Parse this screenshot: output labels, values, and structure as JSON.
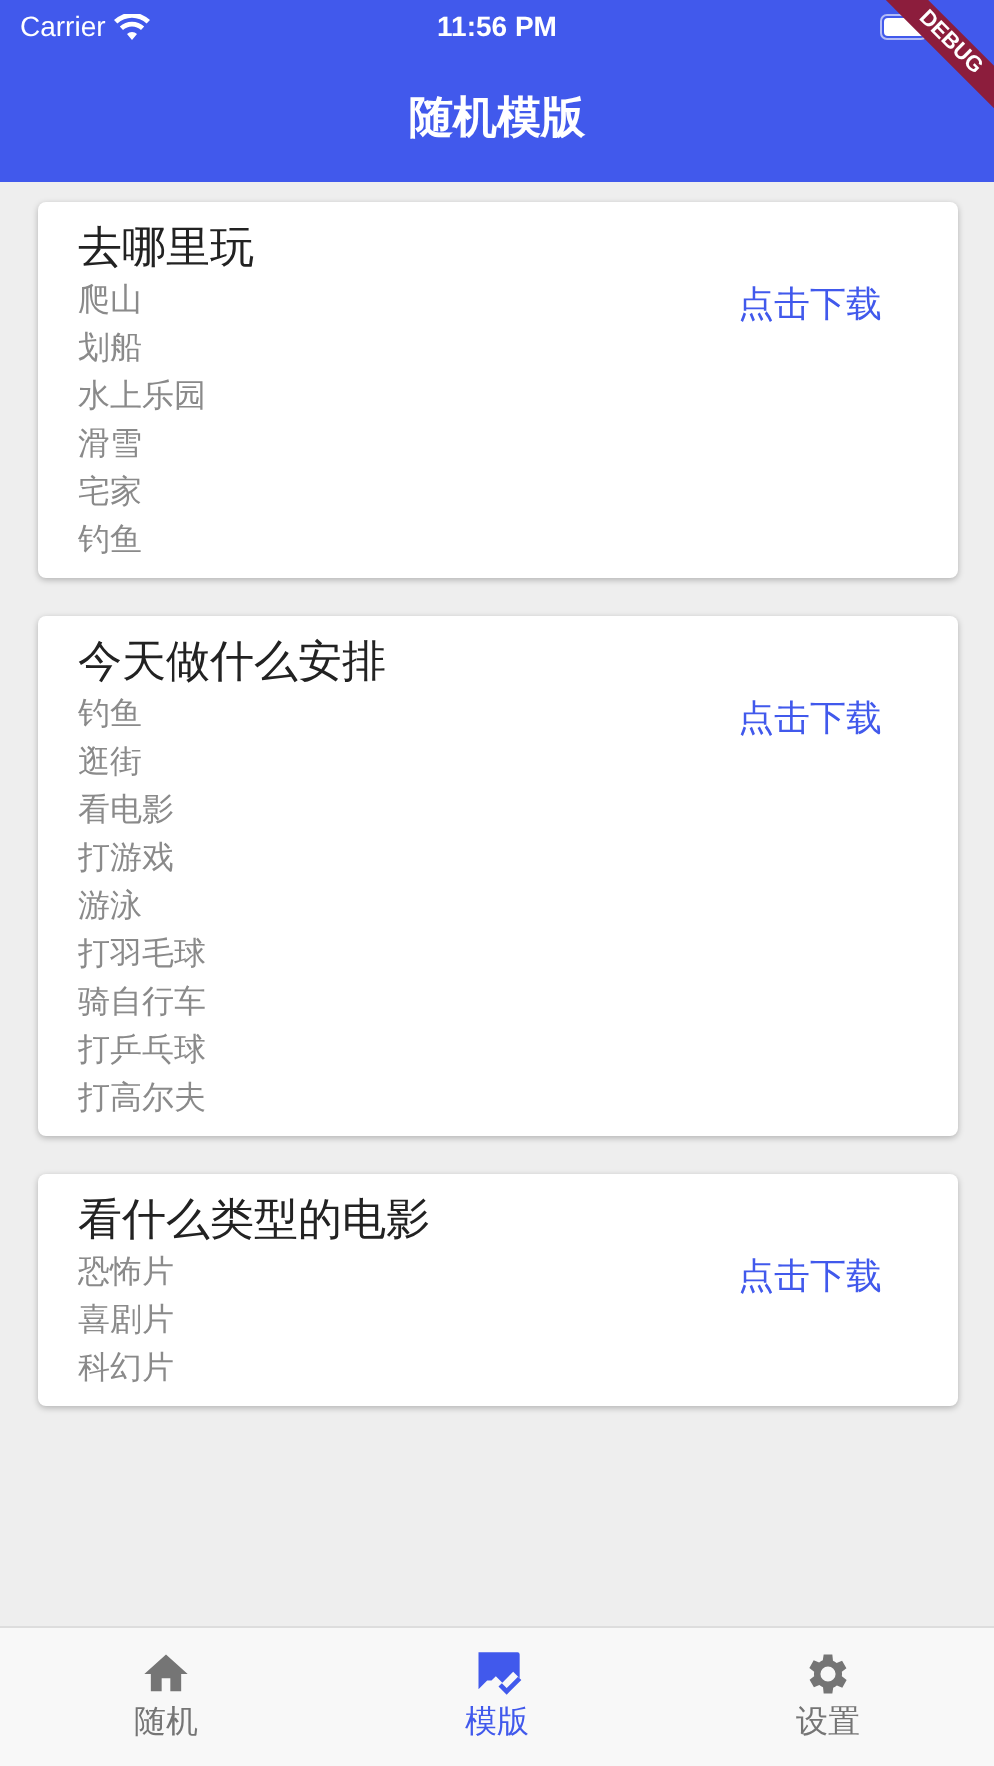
{
  "status_bar": {
    "carrier": "Carrier",
    "time": "11:56 PM"
  },
  "debug_banner": "DEBUG",
  "app_bar": {
    "title": "随机模版"
  },
  "cards": [
    {
      "title": "去哪里玩",
      "items": [
        "爬山",
        "划船",
        "水上乐园",
        "滑雪",
        "宅家",
        "钓鱼"
      ],
      "action": "点击下载"
    },
    {
      "title": "今天做什么安排",
      "items": [
        "钓鱼",
        "逛街",
        "看电影",
        "打游戏",
        "游泳",
        "打羽毛球",
        "骑自行车",
        "打乒乓球",
        "打高尔夫"
      ],
      "action": "点击下载"
    },
    {
      "title": "看什么类型的电影",
      "items": [
        "恐怖片",
        "喜剧片",
        "科幻片"
      ],
      "action": "点击下载"
    }
  ],
  "bottom_nav": [
    {
      "kind": "home",
      "label": "随机",
      "selected": false
    },
    {
      "kind": "template",
      "label": "模版",
      "selected": true
    },
    {
      "kind": "settings",
      "label": "设置",
      "selected": false
    }
  ]
}
